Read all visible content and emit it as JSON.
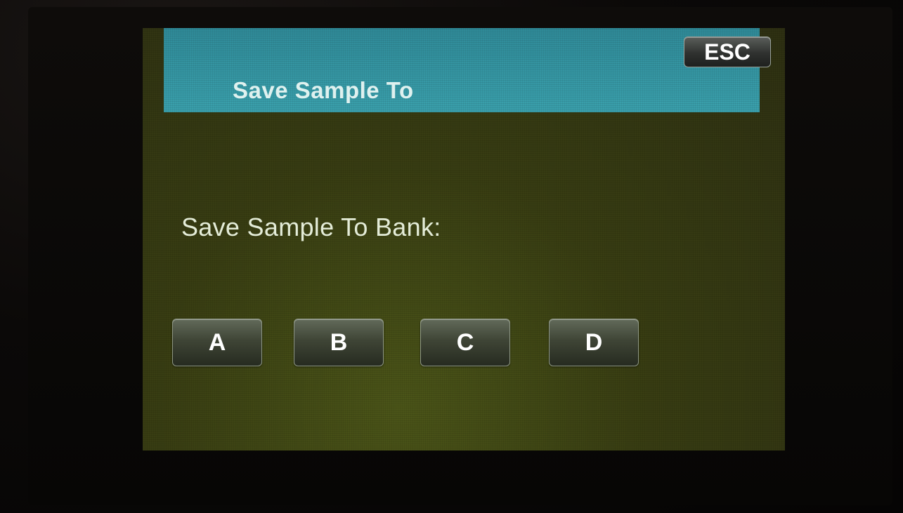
{
  "header": {
    "title": "Save Sample To",
    "esc_label": "ESC"
  },
  "main": {
    "prompt": "Save Sample To Bank:",
    "banks": [
      {
        "label": "A"
      },
      {
        "label": "B"
      },
      {
        "label": "C"
      },
      {
        "label": "D"
      }
    ]
  },
  "colors": {
    "title_bar": "#3aa0ac",
    "screen_background": "#383d12",
    "text": "#e4ecd8"
  }
}
